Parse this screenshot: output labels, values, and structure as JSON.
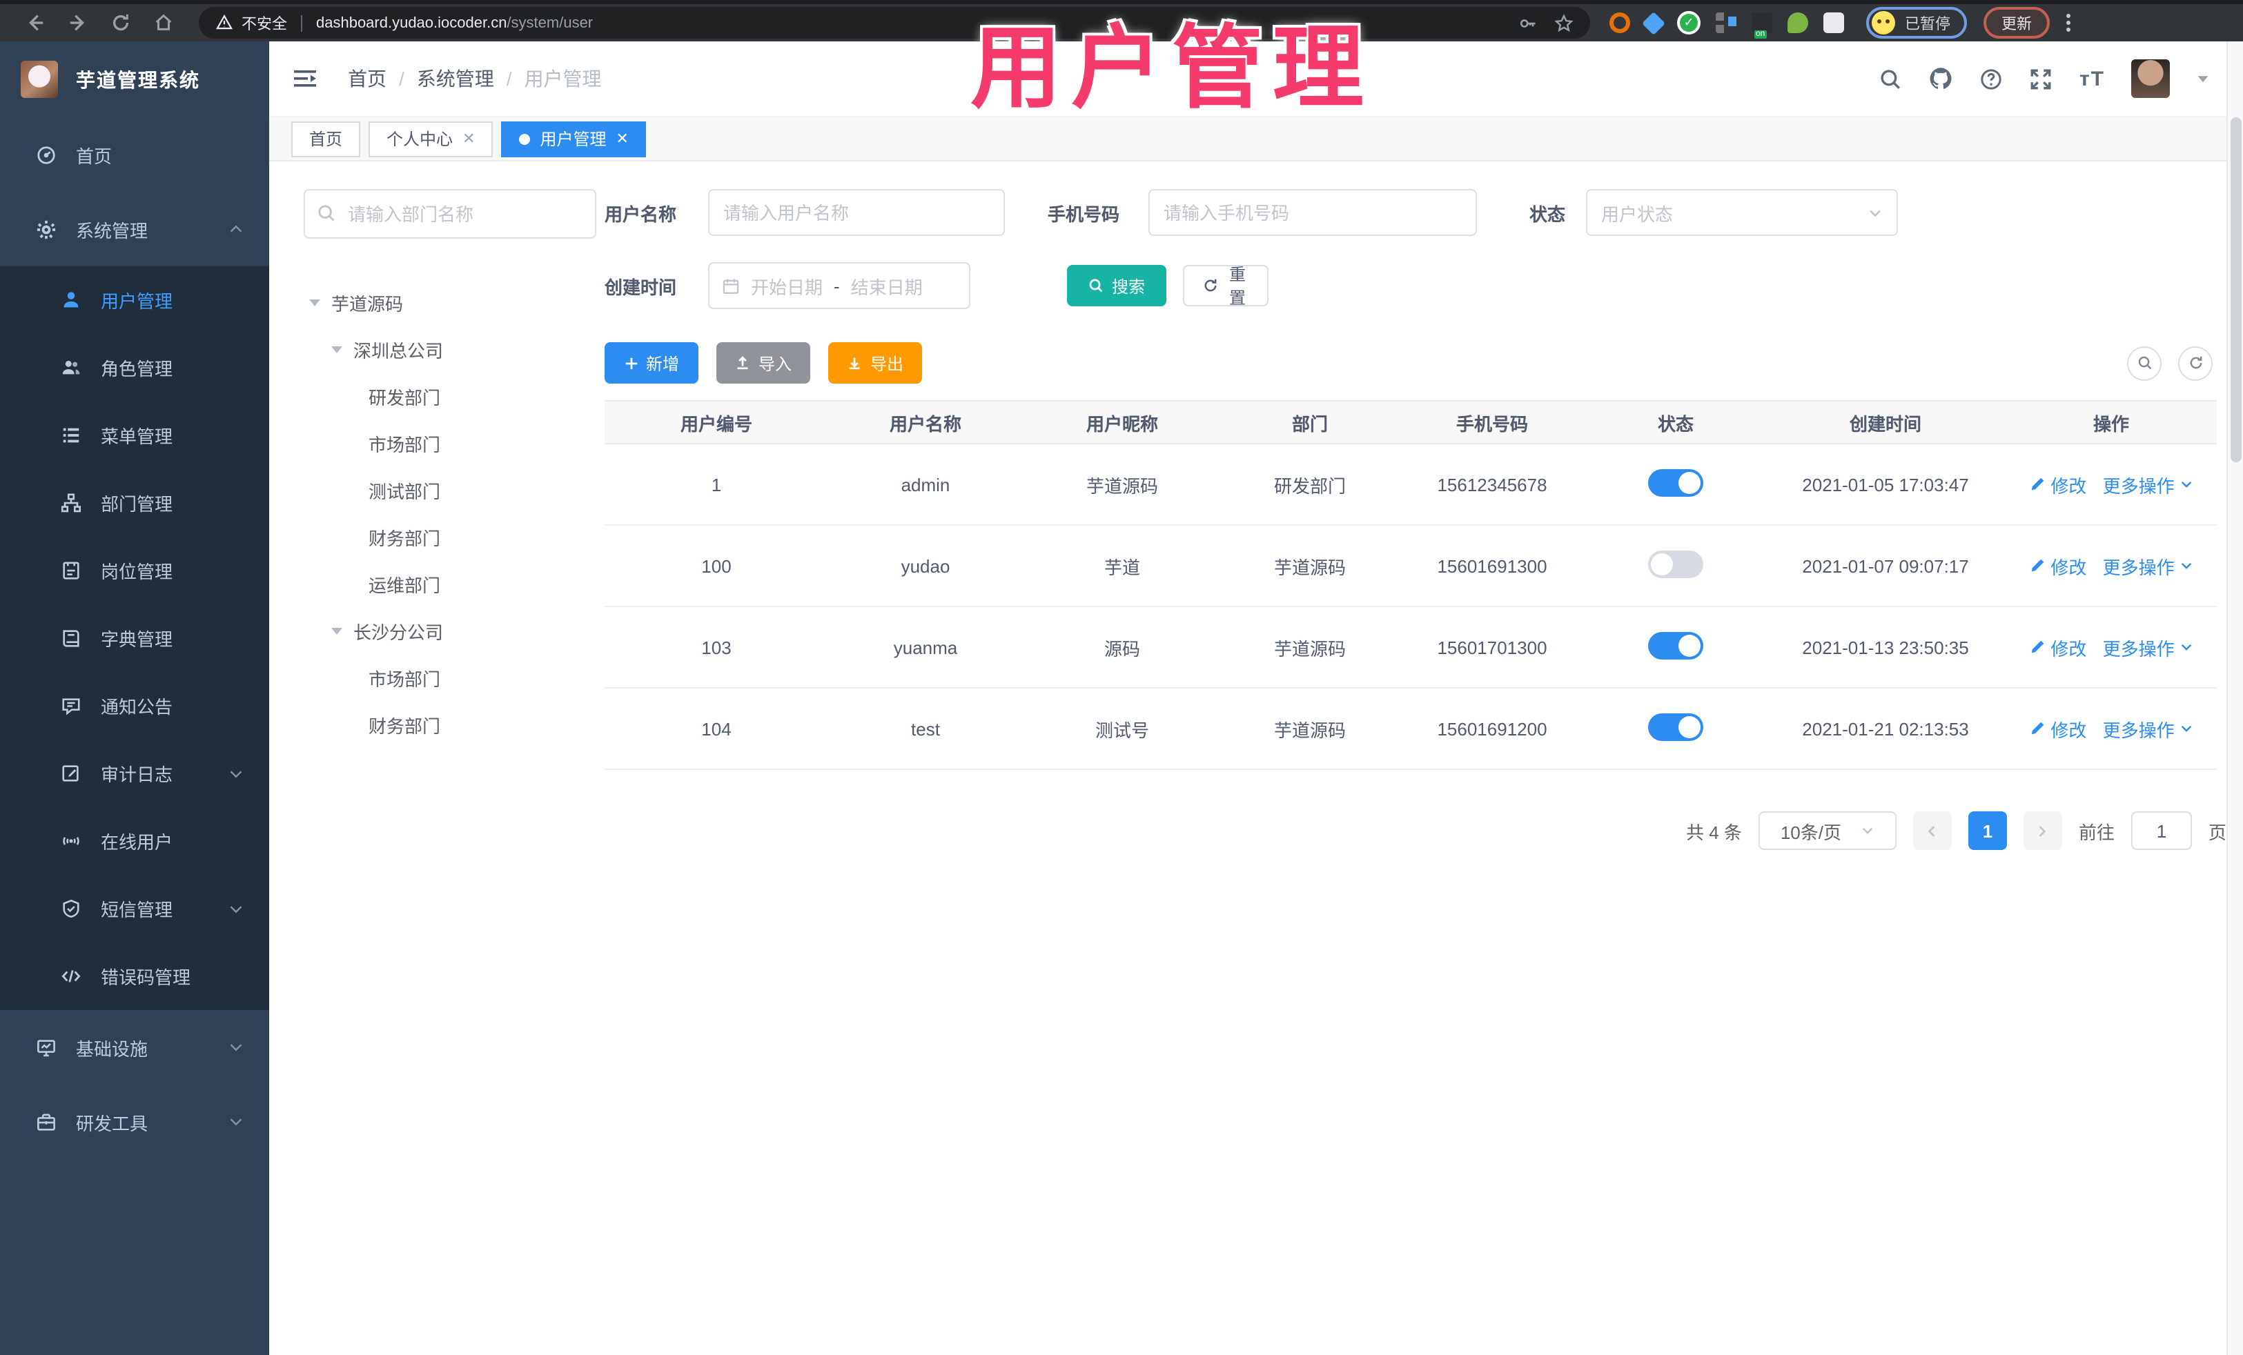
{
  "colors": {
    "primary": "#2d8cf0",
    "active_menu_text": "#409eff",
    "search_teal": "#17b3a3",
    "export_orange": "#ff9900",
    "import_gray": "#909399",
    "sidebar_bg": "#304156",
    "submenu_bg": "#1f2d3d",
    "overlay_pink": "#f53b6b"
  },
  "overlay": {
    "title": "用户管理"
  },
  "browser": {
    "security": "不安全",
    "url_host": "dashboard.yudao.iocoder.cn",
    "url_path": "/system/user",
    "profile_status": "已暂停",
    "update_label": "更新",
    "extensions": [
      "orange-ring",
      "blue-gem",
      "green-check",
      "app-grid",
      "recorder-on",
      "green-plant",
      "puzzle"
    ]
  },
  "app_header": {
    "logo_title": "芋道管理系统",
    "breadcrumb": [
      "首页",
      "系统管理",
      "用户管理"
    ]
  },
  "tabs": [
    {
      "label": "首页",
      "closable": false,
      "active": false
    },
    {
      "label": "个人中心",
      "closable": true,
      "active": false
    },
    {
      "label": "用户管理",
      "closable": true,
      "active": true
    }
  ],
  "sidebar": {
    "top": [
      {
        "label": "首页"
      },
      {
        "label": "系统管理",
        "expanded": true
      }
    ],
    "submenu": [
      {
        "label": "用户管理",
        "active": true
      },
      {
        "label": "角色管理"
      },
      {
        "label": "菜单管理"
      },
      {
        "label": "部门管理"
      },
      {
        "label": "岗位管理"
      },
      {
        "label": "字典管理"
      },
      {
        "label": "通知公告"
      },
      {
        "label": "审计日志",
        "collapsible": true
      },
      {
        "label": "在线用户"
      },
      {
        "label": "短信管理",
        "collapsible": true
      },
      {
        "label": "错误码管理"
      }
    ],
    "bottom": [
      {
        "label": "基础设施",
        "collapsible": true
      },
      {
        "label": "研发工具",
        "collapsible": true
      }
    ]
  },
  "dept": {
    "search_placeholder": "请输入部门名称",
    "tree": {
      "root": "芋道源码",
      "children": [
        {
          "label": "深圳总公司",
          "children": [
            "研发部门",
            "市场部门",
            "测试部门",
            "财务部门",
            "运维部门"
          ]
        },
        {
          "label": "长沙分公司",
          "children": [
            "市场部门",
            "财务部门"
          ]
        }
      ]
    }
  },
  "filters": {
    "username": {
      "label": "用户名称",
      "placeholder": "请输入用户名称"
    },
    "mobile": {
      "label": "手机号码",
      "placeholder": "请输入手机号码"
    },
    "status": {
      "label": "状态",
      "placeholder": "用户状态"
    },
    "create_time": {
      "label": "创建时间",
      "start_placeholder": "开始日期",
      "separator": "-",
      "end_placeholder": "结束日期"
    },
    "search_label": "搜索",
    "reset_label": "重置"
  },
  "toolbar": {
    "add": "新增",
    "import": "导入",
    "export": "导出"
  },
  "table": {
    "headers": [
      "用户编号",
      "用户名称",
      "用户昵称",
      "部门",
      "手机号码",
      "状态",
      "创建时间",
      "操作"
    ],
    "actions": {
      "edit": "修改",
      "more": "更多操作"
    },
    "rows": [
      {
        "id": "1",
        "username": "admin",
        "nickname": "芋道源码",
        "dept": "研发部门",
        "mobile": "15612345678",
        "enabled": true,
        "created": "2021-01-05 17:03:47"
      },
      {
        "id": "100",
        "username": "yudao",
        "nickname": "芋道",
        "dept": "芋道源码",
        "mobile": "15601691300",
        "enabled": false,
        "created": "2021-01-07 09:07:17"
      },
      {
        "id": "103",
        "username": "yuanma",
        "nickname": "源码",
        "dept": "芋道源码",
        "mobile": "15601701300",
        "enabled": true,
        "created": "2021-01-13 23:50:35"
      },
      {
        "id": "104",
        "username": "test",
        "nickname": "测试号",
        "dept": "芋道源码",
        "mobile": "15601691200",
        "enabled": true,
        "created": "2021-01-21 02:13:53"
      }
    ]
  },
  "pagination": {
    "total": "共 4 条",
    "page_size": "10条/页",
    "current": "1",
    "goto_label": "前往",
    "goto_value": "1",
    "page_label": "页"
  }
}
